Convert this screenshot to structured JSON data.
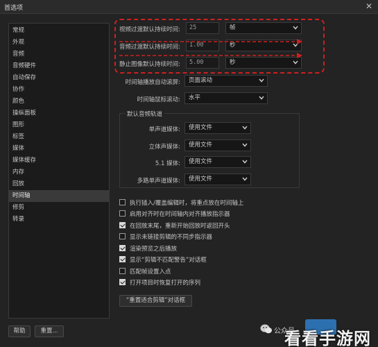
{
  "window": {
    "title": "首选项",
    "close_glyph": "✕"
  },
  "sidebar": {
    "items": [
      "常规",
      "外观",
      "音频",
      "音频硬件",
      "自动保存",
      "协作",
      "颜色",
      "操纵面板",
      "图形",
      "标签",
      "媒体",
      "媒体缓存",
      "内存",
      "回放",
      "时间轴",
      "修剪",
      "转录"
    ],
    "active_index": 14
  },
  "durations": {
    "video": {
      "label": "视频过渡默认持续时间:",
      "value": "25",
      "unit": "帧"
    },
    "audio": {
      "label": "音频过渡默认持续时间:",
      "value": "1.00",
      "unit": "秒"
    },
    "still": {
      "label": "静止图像默认持续时间:",
      "value": "5.00",
      "unit": "秒"
    }
  },
  "timeline": {
    "autoscroll": {
      "label": "时间轴播放自动滚屏:",
      "value": "页面滚动"
    },
    "mousescroll": {
      "label": "时间轴鼠标滚动:",
      "value": "水平"
    }
  },
  "audio_tracks": {
    "title": "默认音频轨道",
    "rows": [
      {
        "label": "单声道媒体:",
        "value": "使用文件"
      },
      {
        "label": "立体声媒体:",
        "value": "使用文件"
      },
      {
        "label": "5.1 媒体:",
        "value": "使用文件"
      },
      {
        "label": "多路单声道媒体:",
        "value": "使用文件"
      }
    ]
  },
  "checkboxes": [
    {
      "label": "执行插入/覆盖编辑时，将重点放在时间轴上",
      "checked": false
    },
    {
      "label": "启用对齐时在时间轴内对齐播放指示器",
      "checked": false
    },
    {
      "label": "在回放末尾，重新开始回放时返回开头",
      "checked": true
    },
    {
      "label": "显示未链接剪辑的不同步指示器",
      "checked": false
    },
    {
      "label": "渲染预览之后播放",
      "checked": true
    },
    {
      "label": "显示“剪辑不匹配警告”对话框",
      "checked": true
    },
    {
      "label": "匹配帧设置入点",
      "checked": false
    },
    {
      "label": "打开项目时恢复打开的序列",
      "checked": true
    }
  ],
  "reset_dialog_button": "“重置适合剪辑”对话框",
  "footer": {
    "help": "帮助",
    "restore": "重置..."
  },
  "watermark": {
    "wechat": "公众号",
    "brand": "看看手游网"
  },
  "colors": {
    "highlight": "#d02020",
    "background": "#232323",
    "panel": "#1b1b1b"
  }
}
